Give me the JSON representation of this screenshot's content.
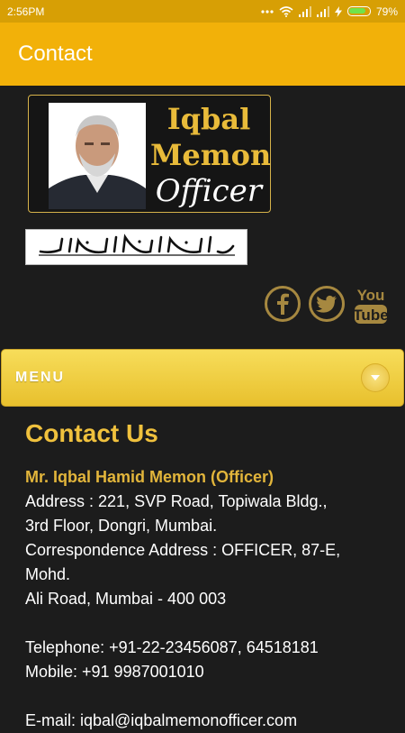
{
  "status_bar": {
    "time": "2:56PM",
    "battery": "79%",
    "icons": [
      "more-dots-icon",
      "wifi-icon",
      "signal-icon",
      "signal-icon",
      "charging-icon",
      "battery-icon"
    ]
  },
  "app_bar": {
    "title": "Contact"
  },
  "logo": {
    "line1": "Iqbal",
    "line2": "Memon",
    "line3": "Officer"
  },
  "bismillah": {
    "text": "بسم الله الرحمن الرحيم"
  },
  "social": {
    "facebook_icon": "facebook-icon",
    "twitter_icon": "twitter-icon",
    "youtube_you": "You",
    "youtube_tube": "Tube"
  },
  "menu": {
    "label": "MENU",
    "toggle_icon": "chevron-down-icon"
  },
  "contact": {
    "heading": "Contact Us",
    "name": "Mr. Iqbal Hamid Memon (Officer)",
    "address": "Address : 221, SVP Road, Topiwala Bldg.,",
    "address_2": "3rd Floor, Dongri, Mumbai.",
    "corr_1": "Correspondence Address : OFFICER, 87-E,",
    "corr_2": "Mohd.",
    "corr_3": "Ali Road, Mumbai - 400 003",
    "telephone": "Telephone: +91-22-23456087, 64518181",
    "mobile": "Mobile: +91 9987001010",
    "email": "E-mail: iqbal@iqbalmemonofficer.com"
  },
  "colors": {
    "status_bar": "#d79f05",
    "app_bar": "#f2b109",
    "background": "#1c1c1c",
    "accent_gold": "#f0c13d",
    "menu_bar": "#efcc40"
  }
}
